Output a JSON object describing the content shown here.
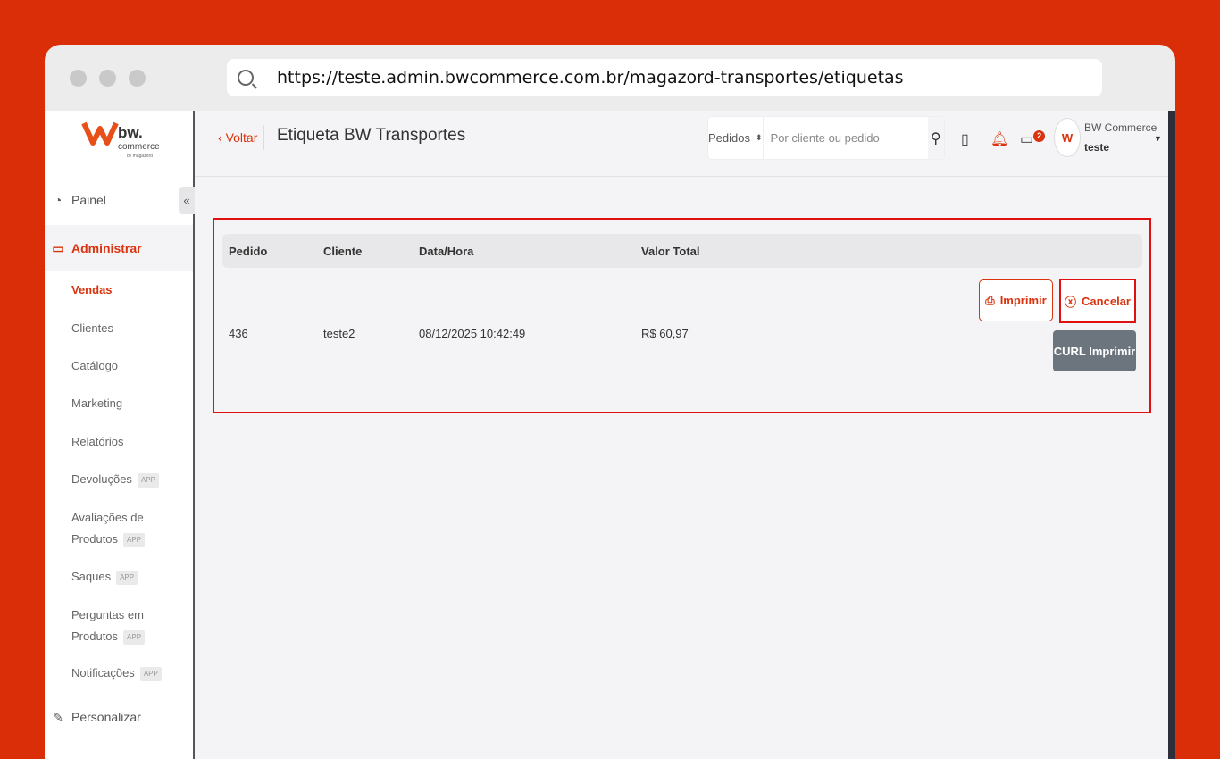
{
  "browser": {
    "url": "https://teste.admin.bwcommerce.com.br/magazord-transportes/etiquetas"
  },
  "logo": {
    "brand": "bw.",
    "sub": "commerce",
    "by": "by magazord"
  },
  "sidebar": {
    "painel": "Painel",
    "administrar": "Administrar",
    "sub": [
      {
        "label": "Vendas"
      },
      {
        "label": "Clientes"
      },
      {
        "label": "Catálogo"
      },
      {
        "label": "Marketing"
      },
      {
        "label": "Relatórios"
      },
      {
        "label": "Devoluções",
        "badge": "APP"
      },
      {
        "label": "Avaliações de",
        "label2": "Produtos",
        "badge": "APP"
      },
      {
        "label": "Saques",
        "badge": "APP"
      },
      {
        "label": "Perguntas em",
        "label2": "Produtos",
        "badge": "APP"
      },
      {
        "label": "Notificações",
        "badge": "APP"
      }
    ],
    "personalizar": "Personalizar",
    "collapse": "«"
  },
  "header": {
    "back": "Voltar",
    "title": "Etiqueta BW Transportes",
    "search_type": "Pedidos",
    "search_placeholder": "Por cliente ou pedido",
    "messages_count": "2",
    "user_company": "BW Commerce",
    "user_name": "teste"
  },
  "table": {
    "columns": [
      "Pedido",
      "Cliente",
      "Data/Hora",
      "Valor Total"
    ],
    "rows": [
      {
        "pedido": "436",
        "cliente": "teste2",
        "data": "08/12/2025 10:42:49",
        "valor": "R$ 60,97"
      }
    ]
  },
  "actions": {
    "print": "Imprimir",
    "cancel": "Cancelar",
    "curl": "CURL Imprimir"
  },
  "colors": {
    "background": "#d92e07",
    "accent": "#d9330f",
    "highlight": "#e01010"
  }
}
